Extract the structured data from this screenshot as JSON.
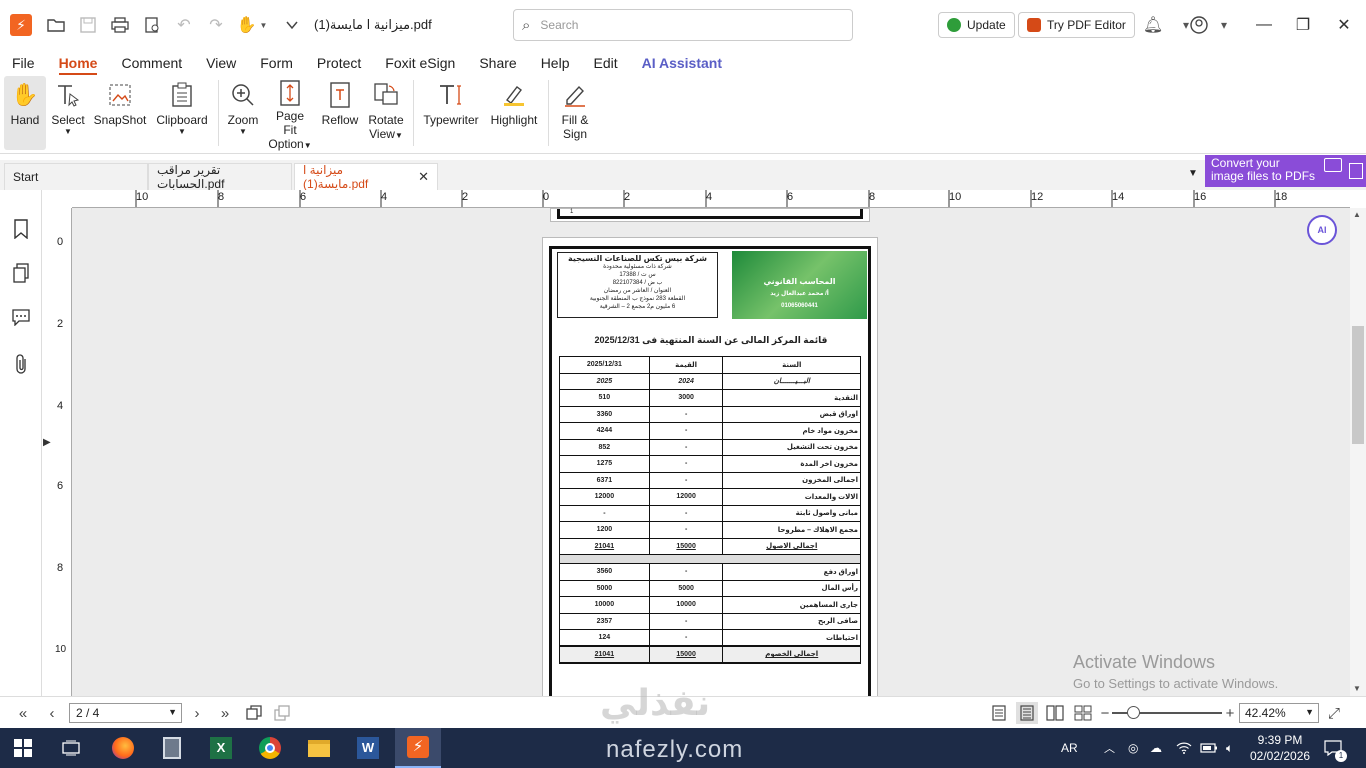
{
  "app": {
    "document_title": "ميزانية ا مايسة(1).pdf",
    "search_placeholder": "Search",
    "update_label": "Update",
    "try_editor_label": "Try PDF Editor"
  },
  "menu": [
    "File",
    "Home",
    "Comment",
    "View",
    "Form",
    "Protect",
    "Foxit eSign",
    "Share",
    "Help",
    "Edit",
    "AI Assistant"
  ],
  "ribbon": {
    "hand": "Hand",
    "select": "Select",
    "snapshot": "SnapShot",
    "clipboard": "Clipboard",
    "zoom": "Zoom",
    "page_fit_1": "Page Fit",
    "page_fit_2": "Option",
    "reflow": "Reflow",
    "rotate_1": "Rotate",
    "rotate_2": "View",
    "typewriter": "Typewriter",
    "highlight": "Highlight",
    "fill_sign_1": "Fill &",
    "fill_sign_2": "Sign"
  },
  "tabs": {
    "start": "Start",
    "tab1": "تقرير مراقب الحسابات.pdf",
    "tab2": "ميزانية ا مايسة(1).pdf"
  },
  "banner": {
    "line1": "Convert your",
    "line2": "image files to PDFs"
  },
  "ruler": {
    "h": [
      "10",
      "8",
      "6",
      "4",
      "2",
      "0",
      "2",
      "4",
      "6",
      "8",
      "10",
      "12",
      "14",
      "16",
      "18"
    ],
    "v": [
      "0",
      "2",
      "4",
      "6",
      "8",
      "10"
    ]
  },
  "document": {
    "prev_page_mark": "1",
    "company_name": "شركة بيس تكس للصناعات النسيجية",
    "company_lines": [
      "شركة ذات مسئولية محدودة",
      "س ت / 17388",
      "ب ض / 822107384",
      "العنوان / العاشر من رمضان",
      "القطعة 283 نموذج ب المنطقة الجنوبية",
      "6 مليون م2 مجمع 2 – الشرقية"
    ],
    "logo_text": "المحاسب القانوني",
    "logo_sub": "أ/ محمد عبدالعال زيد",
    "logo_phone": "01065060441",
    "heading": "قائمة المركز المالى عن السنة المنتهية فى 2025/12/31",
    "col_year": "السنة",
    "col_value": "القيمة",
    "col_date": "2025/12/31",
    "col_statement": "البـــيـــــــان",
    "col_2024": "2024",
    "col_2025": "2025",
    "rows_assets": [
      {
        "label": "النقدية",
        "v2024": "3000",
        "v2025": "510"
      },
      {
        "label": "اوراق قبض",
        "v2024": "-",
        "v2025": "3360"
      },
      {
        "label": "مخزون مواد خام",
        "v2024": "-",
        "v2025": "4244"
      },
      {
        "label": "مخزون تحت التشغيل",
        "v2024": "-",
        "v2025": "852"
      },
      {
        "label": "مخزون اخر المدة",
        "v2024": "-",
        "v2025": "1275"
      },
      {
        "label": "اجمالى المخزون",
        "v2024": "-",
        "v2025": "6371"
      },
      {
        "label": "الالات والمعدات",
        "v2024": "12000",
        "v2025": "12000"
      },
      {
        "label": "مبانى واصول ثابتة",
        "v2024": "-",
        "v2025": "-"
      },
      {
        "label": "مجمع الاهلاك – مطروحا",
        "v2024": "-",
        "v2025": "1200"
      }
    ],
    "total_assets": {
      "label": "اجمالى الاصول",
      "v2024": "15000",
      "v2025": "21041"
    },
    "rows_liabilities": [
      {
        "label": "اوراق دفع",
        "v2024": "-",
        "v2025": "3560"
      },
      {
        "label": "رأس المال",
        "v2024": "5000",
        "v2025": "5000"
      },
      {
        "label": "جارى المساهمين",
        "v2024": "10000",
        "v2025": "10000"
      },
      {
        "label": "صافى الربح",
        "v2024": "-",
        "v2025": "2357"
      },
      {
        "label": "احتياطات",
        "v2024": "-",
        "v2025": "124"
      }
    ],
    "total_liabilities": {
      "label": "اجمالى الخصوم",
      "v2024": "15000",
      "v2025": "21041"
    }
  },
  "ai_badge": "AI",
  "watermark": {
    "line1": "Activate Windows",
    "line2": "Go to Settings to activate Windows."
  },
  "status": {
    "page_indicator": "2 / 4",
    "zoom_value": "42.42%"
  },
  "overlay": {
    "nafezly_ar": "نفذلي",
    "nafezly_url": "nafezly.com"
  },
  "taskbar": {
    "lang": "AR",
    "time": "9:39 PM",
    "date": "02/02/2026",
    "notifications": "1"
  },
  "colors": {
    "accent": "#d54a17",
    "ai_color": "#5a5ec6",
    "banner": "#8a4cd8",
    "taskbar": "#1d2b47"
  }
}
